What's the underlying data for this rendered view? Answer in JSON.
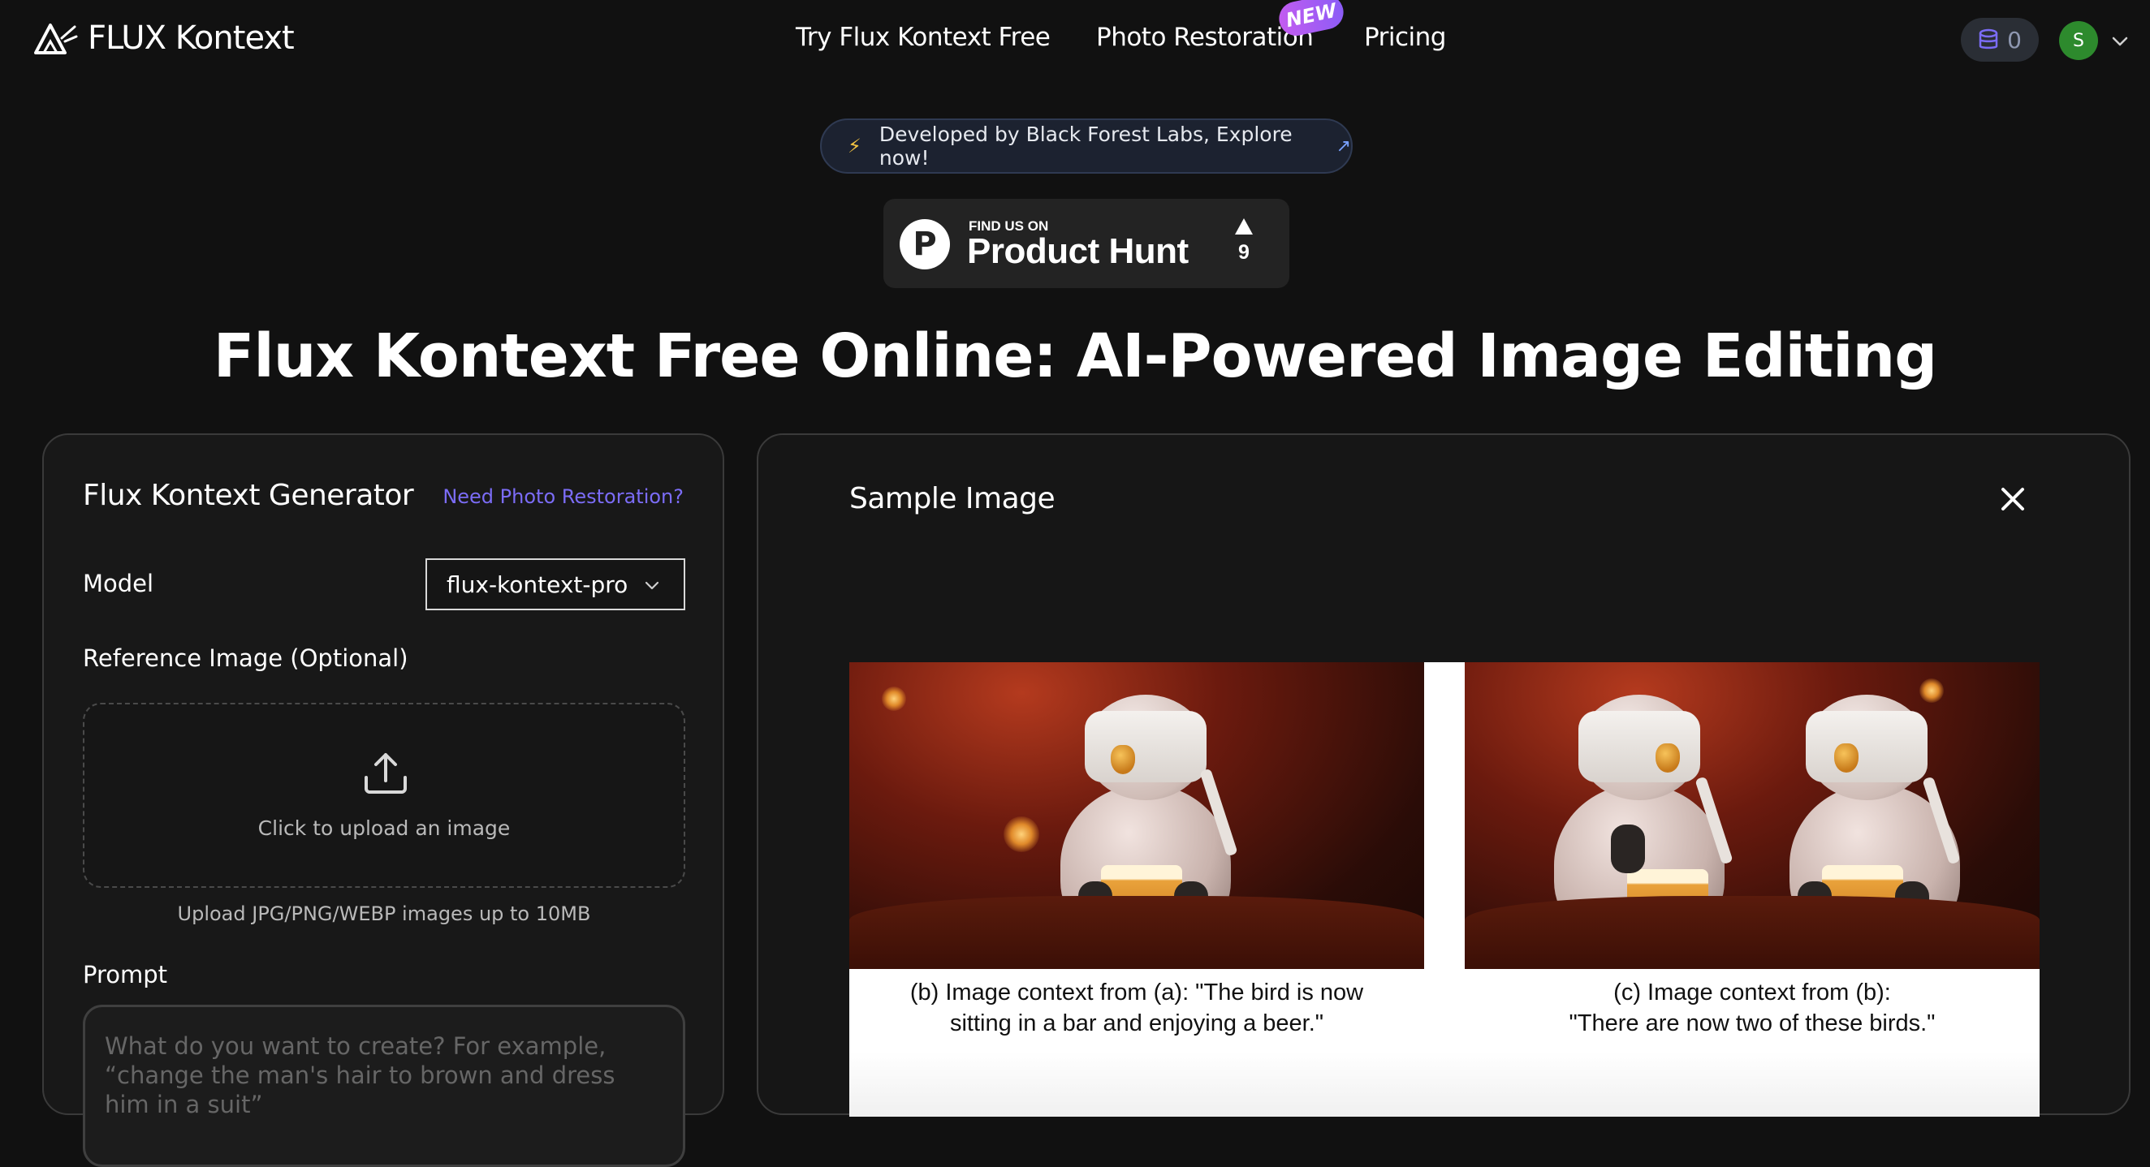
{
  "nav": {
    "logo_text": "FLUX Kontext",
    "links": [
      "Try Flux Kontext Free",
      "Photo Restoration",
      "Pricing"
    ],
    "new_badge": "NEW",
    "credits": "0",
    "avatar_initial": "S"
  },
  "announcement": {
    "text": "Developed by Black Forest Labs, Explore now!"
  },
  "product_hunt": {
    "badge_small": "FIND US ON",
    "badge_large": "Product Hunt",
    "upvotes": "9"
  },
  "headline": "Flux Kontext Free Online: AI-Powered Image Editing",
  "generator": {
    "title": "Flux Kontext Generator",
    "restoration_link": "Need Photo Restoration?",
    "model_label": "Model",
    "model_value": "flux-kontext-pro",
    "reference_label": "Reference Image (Optional)",
    "upload_text": "Click to upload an image",
    "upload_hint": "Upload JPG/PNG/WEBP images up to 10MB",
    "prompt_label": "Prompt",
    "prompt_placeholder": "What do you want to create? For example, “change the man's hair to brown and dress him in a suit”"
  },
  "sample": {
    "title": "Sample Image",
    "caption_left_line1": "(b) Image context from (a): \"The bird is now",
    "caption_left_line2": "sitting in a bar and enjoying a beer.\"",
    "caption_right_line1": "(c) Image context from (b):",
    "caption_right_line2": "\"There are now two of these birds.\""
  },
  "colors": {
    "background": "#111111",
    "accent_link": "#7b6cf6",
    "avatar": "#2d8a2d",
    "new_badge": "#a45cf0"
  }
}
